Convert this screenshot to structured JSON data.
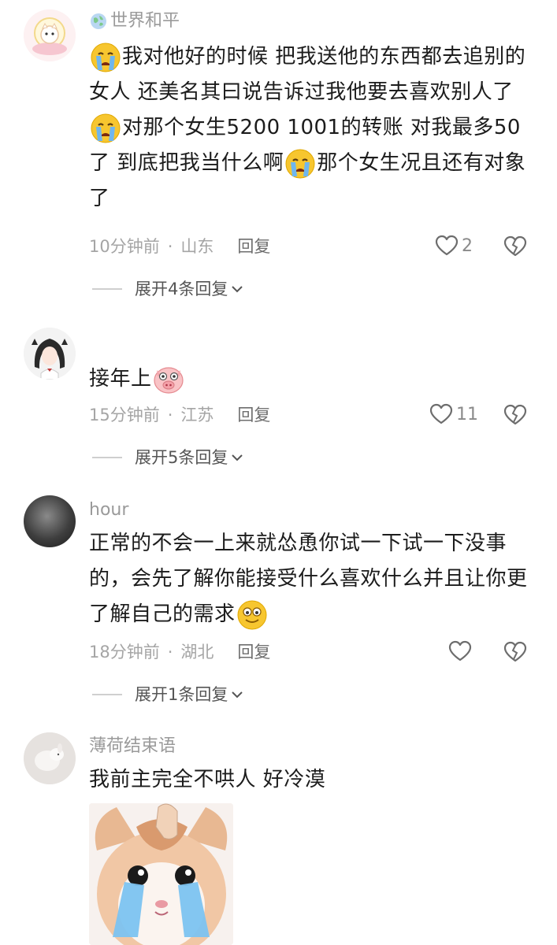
{
  "comments": [
    {
      "username": "世界和平",
      "text_parts": [
        "我对他好的时候 把我送他的东西都去追别的女人 还美名其曰说告诉过我他要去喜欢别人了",
        "对那个女生5200 1001的转账 对我最多50了 到底把我当什么啊",
        "那个女生况且还有对象了"
      ],
      "time": "10分钟前",
      "location": "山东",
      "reply_label": "回复",
      "likes": "2",
      "expand_label": "展开4条回复"
    },
    {
      "username": "",
      "text": "接年上",
      "time": "15分钟前",
      "location": "江苏",
      "reply_label": "回复",
      "likes": "11",
      "expand_label": "展开5条回复"
    },
    {
      "username": "hour",
      "text": "正常的不会一上来就怂恿你试一下试一下没事的，会先了解你能接受什么喜欢什么并且让你更了解自己的需求",
      "time": "18分钟前",
      "location": "湖北",
      "reply_label": "回复",
      "likes": "",
      "expand_label": "展开1条回复"
    },
    {
      "username": "薄荷结束语",
      "text": "我前主完全不哄人 好冷漠"
    }
  ],
  "icons": {
    "location_badge": "globe-icon",
    "emoji_cry": "crying-emoji",
    "emoji_pig": "pig-emoji",
    "emoji_smile": "smile-emoji",
    "like": "heart-icon",
    "dislike": "broken-heart-icon",
    "expand": "chevron-down-icon"
  },
  "colors": {
    "secondary_text": "#9a9a9a",
    "body_text": "#1c1c1c",
    "emoji_yellow": "#f7c62f"
  }
}
